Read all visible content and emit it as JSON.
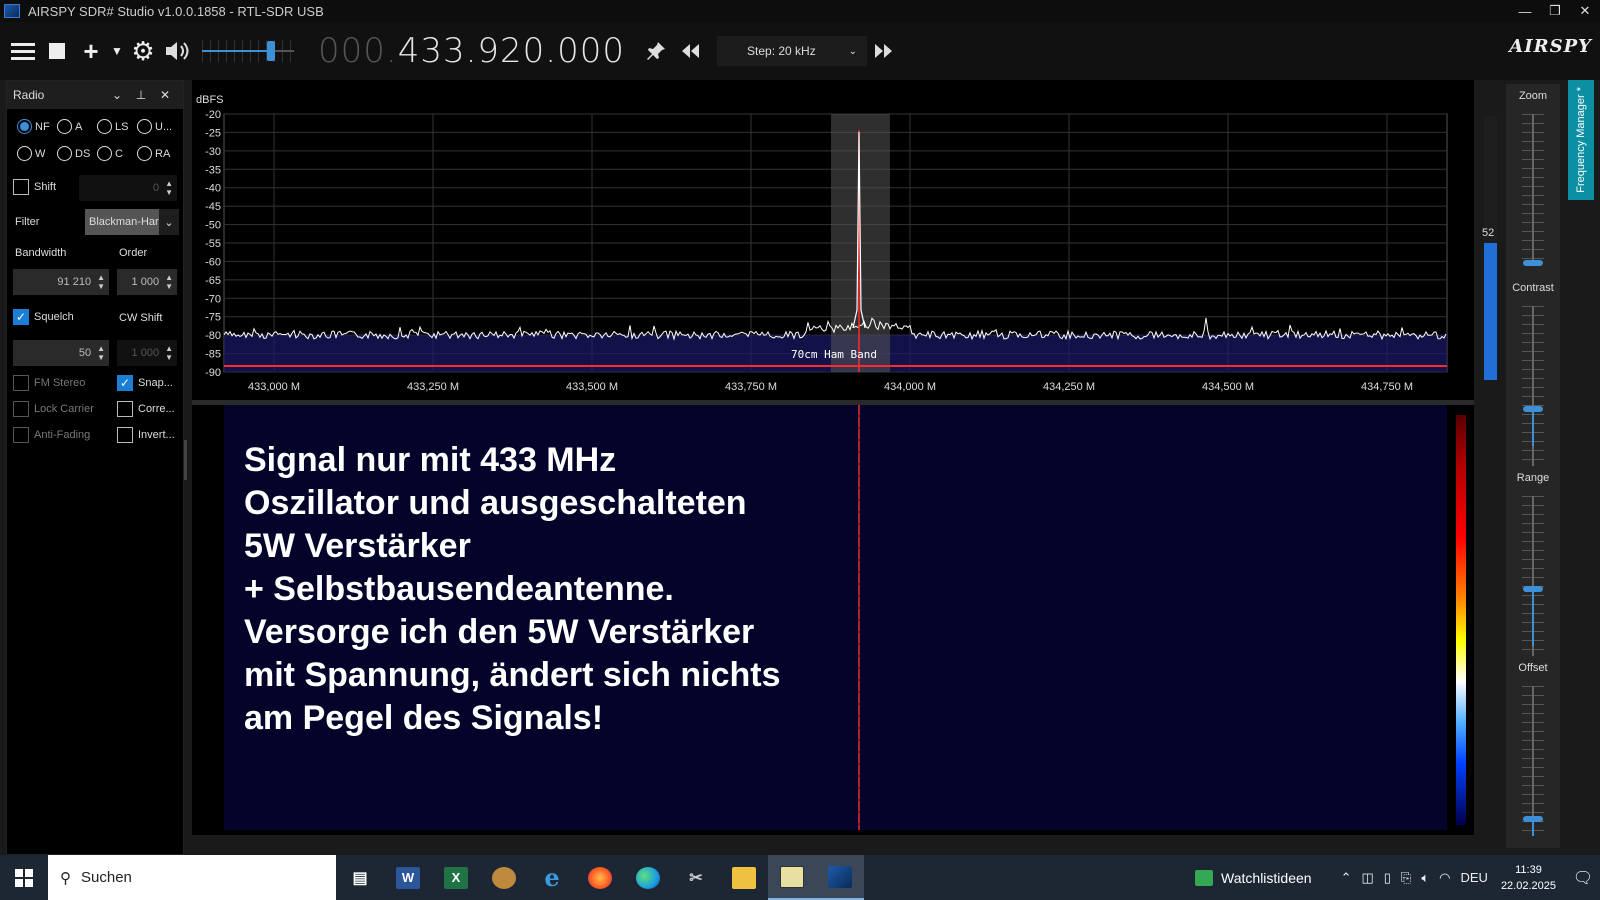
{
  "window": {
    "title": "AIRSPY SDR# Studio v1.0.0.1858 - RTL-SDR USB",
    "minimize": "—",
    "restore": "❐",
    "close": "✕"
  },
  "toolbar": {
    "frequency_dim": "000.",
    "frequency": "433.920.000",
    "step_label": "Step: 20 kHz",
    "volume_level": 0.75,
    "brand": "AIRSPY"
  },
  "radio_panel": {
    "title": "Radio",
    "modes": [
      {
        "label": "NF",
        "selected": true
      },
      {
        "label": "A",
        "selected": false
      },
      {
        "label": "LS",
        "selected": false
      },
      {
        "label": "U...",
        "selected": false
      },
      {
        "label": "W",
        "selected": false
      },
      {
        "label": "DS",
        "selected": false
      },
      {
        "label": "C",
        "selected": false
      },
      {
        "label": "RA",
        "selected": false
      }
    ],
    "shift_label": "Shift",
    "shift_value": "0",
    "filter_label": "Filter",
    "filter_value": "Blackman-Har",
    "bandwidth_label": "Bandwidth",
    "bandwidth_value": "91 210",
    "order_label": "Order",
    "order_value": "1 000",
    "squelch_label": "Squelch",
    "squelch_value": "50",
    "cw_shift_label": "CW Shift",
    "cw_shift_value": "1 000",
    "fm_stereo_label": "FM Stereo",
    "snap_label": "Snap...",
    "lock_carrier_label": "Lock Carrier",
    "correct_label": "Corre...",
    "anti_fading_label": "Anti-Fading",
    "invert_label": "Invert..."
  },
  "spectrum": {
    "unit_label": "dBFS",
    "y_ticks": [
      "-20",
      "-25",
      "-30",
      "-35",
      "-40",
      "-45",
      "-50",
      "-55",
      "-60",
      "-65",
      "-70",
      "-75",
      "-80",
      "-85",
      "-90"
    ],
    "x_ticks": [
      "433,000 M",
      "433,250 M",
      "433,500 M",
      "433,750 M",
      "434,000 M",
      "434,250 M",
      "434,500 M",
      "434,750 M"
    ],
    "band_label": "70cm Ham Band",
    "level_value": "52",
    "level_fraction": 0.52,
    "colors": {
      "trace": "#ffffff",
      "signal": "#ff2a2a",
      "band": "#1a1a66",
      "filter": "#555555"
    }
  },
  "waterfall": {
    "annotation": "Signal nur mit 433 MHz\nOszillator und ausgeschalteten\n5W Verstärker\n+ Selbstbausendeantenne.\nVersorge ich den 5W Verstärker\nmit Spannung, ändert sich nichts\nam Pegel des Signals!"
  },
  "side_controls": {
    "zoom_label": "Zoom",
    "contrast_label": "Contrast",
    "range_label": "Range",
    "offset_label": "Offset",
    "freq_manager_tab": "Frequency Manager *"
  },
  "taskbar": {
    "search_placeholder": "Suchen",
    "weather_label": "Watchlistideen",
    "language": "DEU",
    "time": "11:39",
    "date": "22.02.2025"
  }
}
